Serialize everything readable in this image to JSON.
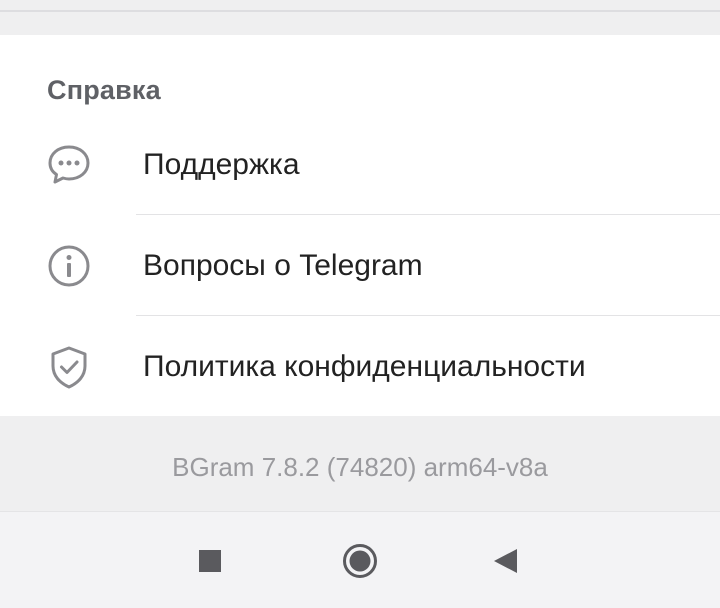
{
  "help_section": {
    "header": "Справка",
    "items": [
      {
        "label": "Поддержка",
        "icon": "chat-bubble-icon"
      },
      {
        "label": "Вопросы о Telegram",
        "icon": "info-icon"
      },
      {
        "label": "Политика конфиденциальности",
        "icon": "shield-check-icon"
      }
    ]
  },
  "footer": {
    "version": "BGram 7.8.2 (74820) arm64-v8a"
  },
  "nav_bar": {
    "buttons": [
      "recents-button",
      "home-button",
      "back-button"
    ]
  },
  "colors": {
    "background": "#efeff0",
    "card": "#ffffff",
    "header_text": "#5f6166",
    "item_text": "#222222",
    "icon": "#8a8a8e",
    "version_text": "#9a9a9e"
  }
}
